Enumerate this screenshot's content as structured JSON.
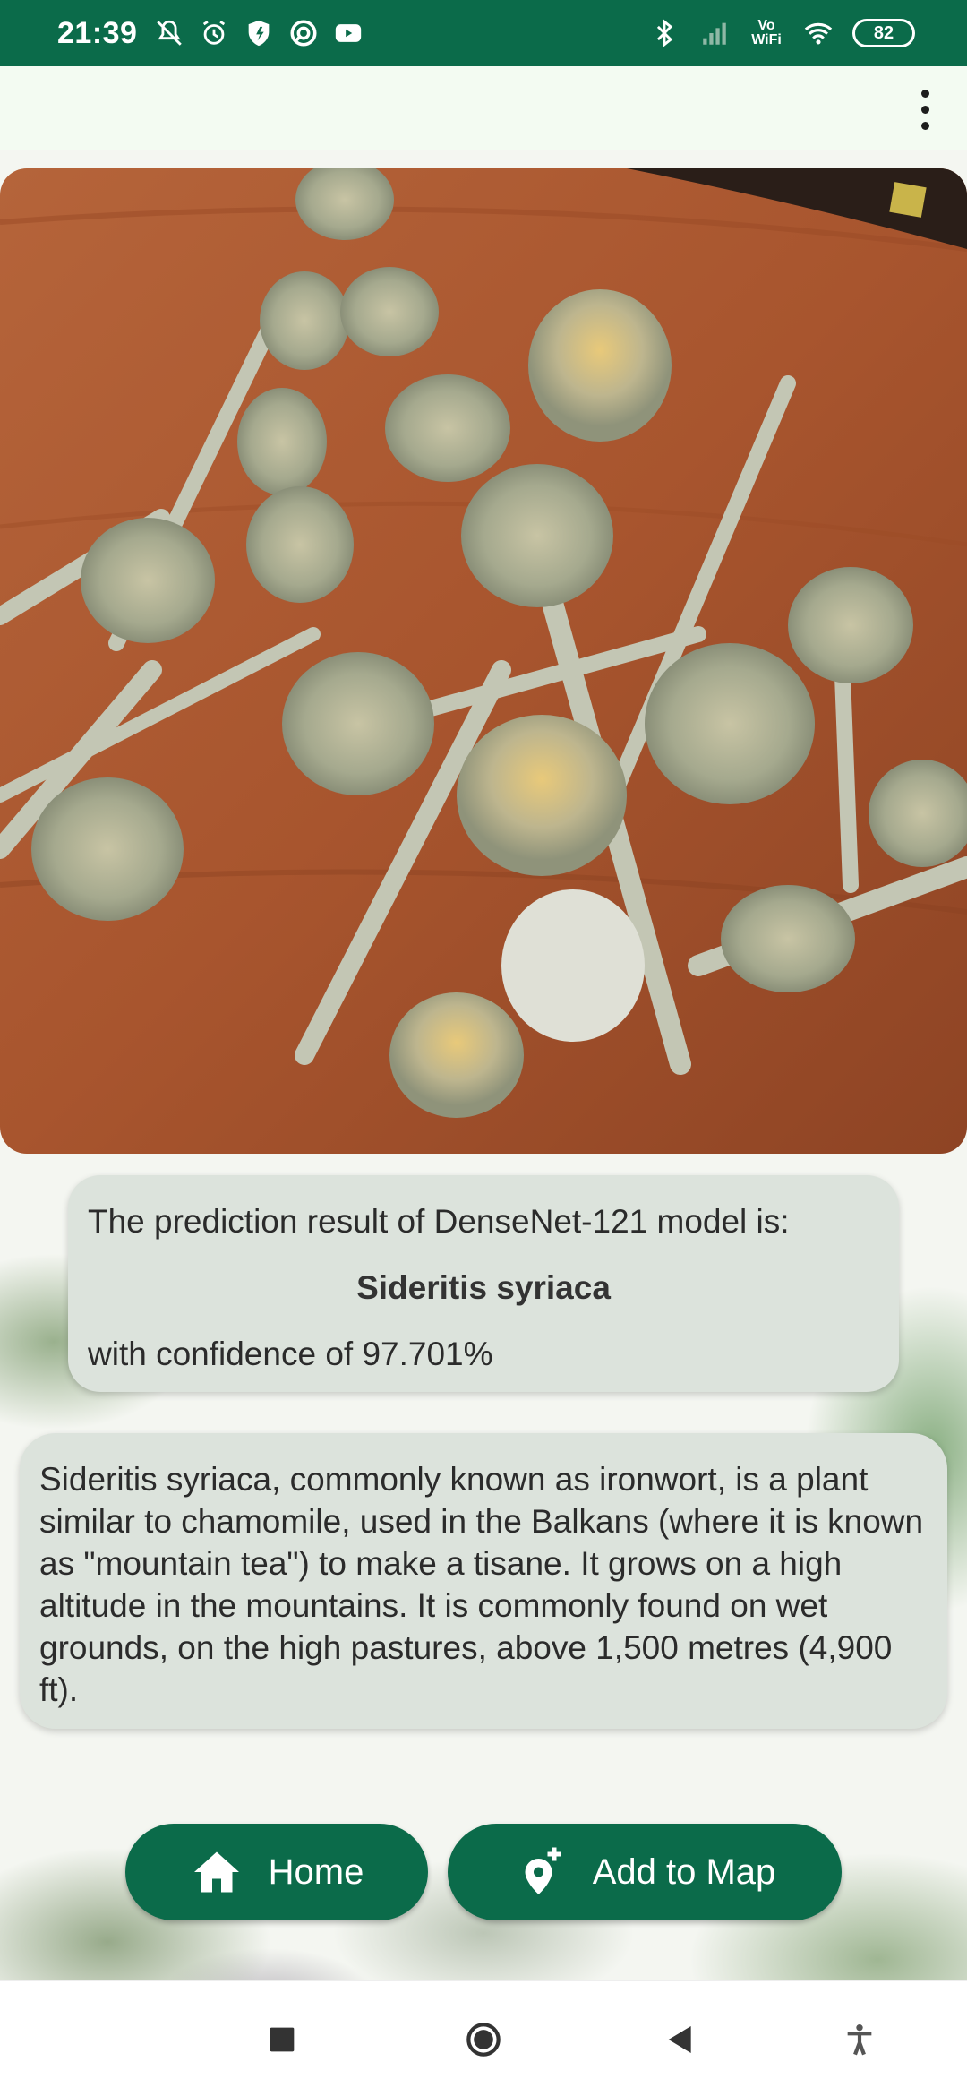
{
  "status_bar": {
    "time": "21:39",
    "left_icons": [
      "mute-icon",
      "alarm-icon",
      "shield-icon",
      "data-saver-icon",
      "youtube-icon"
    ],
    "right_icons": [
      "bluetooth-icon",
      "signal-icon",
      "vowifi-icon",
      "wifi-icon",
      "battery-icon"
    ],
    "vowifi_label": "Vo\nWiFi",
    "battery_level": "82"
  },
  "app_bar": {
    "menu_icon": "overflow-menu-icon"
  },
  "photo": {
    "subject": "plant-photo"
  },
  "prediction": {
    "line": "The prediction result of DenseNet-121 model is:",
    "name": "Sideritis syriaca",
    "confidence": "with confidence of 97.701%"
  },
  "description": {
    "text": "Sideritis syriaca, commonly known as ironwort, is a plant similar to chamomile, used in the Balkans (where it is known as \"mountain tea\") to make a tisane. It grows on a high altitude in the mountains. It is commonly found on wet grounds, on the high pastures, above 1,500 metres (4,900 ft)."
  },
  "actions": {
    "home_label": "Home",
    "map_label": "Add to Map"
  },
  "colors": {
    "primary": "#0b6b4a",
    "card": "#dce3dc",
    "app_bar": "#f3fbf2"
  }
}
